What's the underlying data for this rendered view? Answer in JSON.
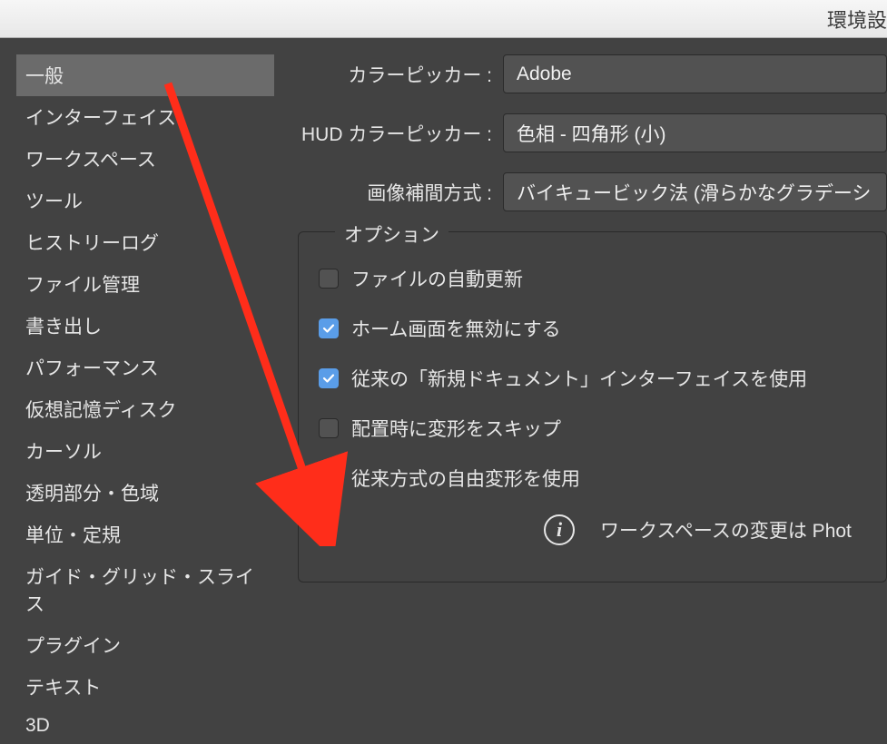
{
  "window": {
    "title": "環境設"
  },
  "sidebar": {
    "items": [
      {
        "label": "一般",
        "selected": true
      },
      {
        "label": "インターフェイス"
      },
      {
        "label": "ワークスペース"
      },
      {
        "label": "ツール"
      },
      {
        "label": "ヒストリーログ"
      },
      {
        "label": "ファイル管理"
      },
      {
        "label": "書き出し"
      },
      {
        "label": "パフォーマンス"
      },
      {
        "label": "仮想記憶ディスク"
      },
      {
        "label": "カーソル"
      },
      {
        "label": "透明部分・色域"
      },
      {
        "label": "単位・定規"
      },
      {
        "label": "ガイド・グリッド・スライス"
      },
      {
        "label": "プラグイン"
      },
      {
        "label": "テキスト"
      },
      {
        "label": "3D"
      }
    ]
  },
  "settings": {
    "colorPicker": {
      "label": "カラーピッカー :",
      "value": "Adobe"
    },
    "hudPicker": {
      "label": "HUD カラーピッカー :",
      "value": "色相 - 四角形 (小)"
    },
    "interp": {
      "label": "画像補間方式 :",
      "value": "バイキュービック法 (滑らかなグラデーシ"
    }
  },
  "options": {
    "legend": "オプション",
    "items": [
      {
        "label": "ファイルの自動更新",
        "checked": false
      },
      {
        "label": "ホーム画面を無効にする",
        "checked": true
      },
      {
        "label": "従来の「新規ドキュメント」インターフェイスを使用",
        "checked": true
      },
      {
        "label": "配置時に変形をスキップ",
        "checked": false
      },
      {
        "label": "従来方式の自由変形を使用",
        "checked": true
      }
    ],
    "info": "ワークスペースの変更は Phot"
  }
}
